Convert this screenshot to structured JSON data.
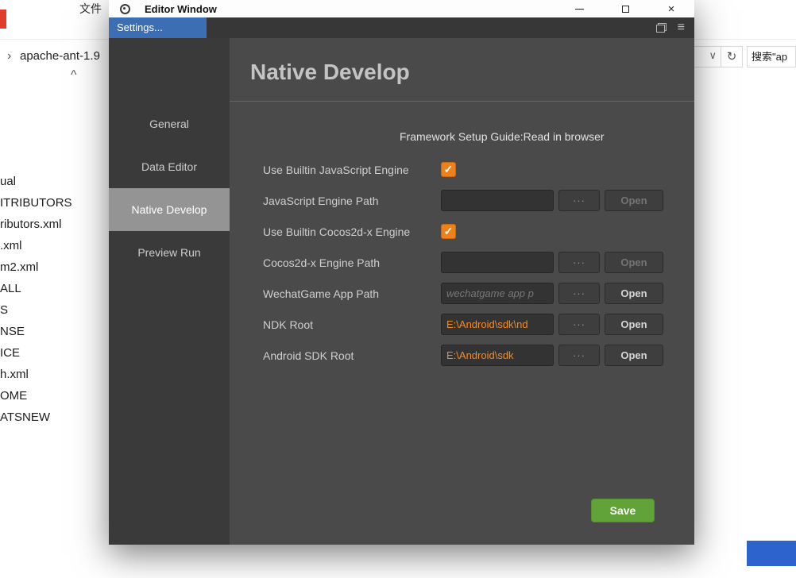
{
  "explorer": {
    "menu_item": "文件",
    "address": {
      "chevron": "›",
      "path": "apache-ant-1.9",
      "dropdown_icon": "∨",
      "refresh_icon": "↻"
    },
    "search": {
      "text": "搜索\"ap"
    },
    "scroll_up_icon": "^",
    "files": [
      "ual",
      "ITRIBUTORS",
      "ributors.xml",
      ".xml",
      "m2.xml",
      "ALL",
      "S",
      "NSE",
      "ICE",
      "h.xml",
      "OME",
      "ATSNEW"
    ]
  },
  "dialog": {
    "title": "Editor Window",
    "window_controls": {
      "close_icon": "×"
    },
    "tab_bar": {
      "settings_tab": "Settings...",
      "menu_icon": "≡"
    },
    "sidebar": {
      "items": [
        {
          "label": "General",
          "selected": false
        },
        {
          "label": "Data Editor",
          "selected": false
        },
        {
          "label": "Native Develop",
          "selected": true
        },
        {
          "label": "Preview Run",
          "selected": false
        }
      ]
    },
    "content": {
      "title": "Native Develop",
      "guide": "Framework Setup Guide:Read in browser",
      "check_icon": "✓",
      "more_label": "···",
      "open_label": "Open",
      "save_label": "Save",
      "rows": [
        {
          "label": "Use Builtin JavaScript Engine",
          "type": "checkbox",
          "checked": true
        },
        {
          "label": "JavaScript Engine Path",
          "type": "path",
          "value": "",
          "placeholder": "",
          "open_enabled": false
        },
        {
          "label": "Use Builtin Cocos2d-x Engine",
          "type": "checkbox",
          "checked": true
        },
        {
          "label": "Cocos2d-x Engine Path",
          "type": "path",
          "value": "",
          "placeholder": "",
          "open_enabled": false
        },
        {
          "label": "WechatGame App Path",
          "type": "path",
          "value": "",
          "placeholder": "wechatgame app p",
          "open_enabled": true
        },
        {
          "label": "NDK Root",
          "type": "path",
          "value": "E:\\Android\\sdk\\nd",
          "placeholder": "",
          "open_enabled": true
        },
        {
          "label": "Android SDK Root",
          "type": "path",
          "value": "E:\\Android\\sdk",
          "placeholder": "",
          "open_enabled": true
        }
      ]
    }
  },
  "colors": {
    "settings_tab_blue": "#3c6eb4",
    "accent_orange": "#ee8119",
    "path_text_orange": "#f78a20",
    "save_green": "#62a339",
    "selected_sidebar_gray": "#949494"
  }
}
